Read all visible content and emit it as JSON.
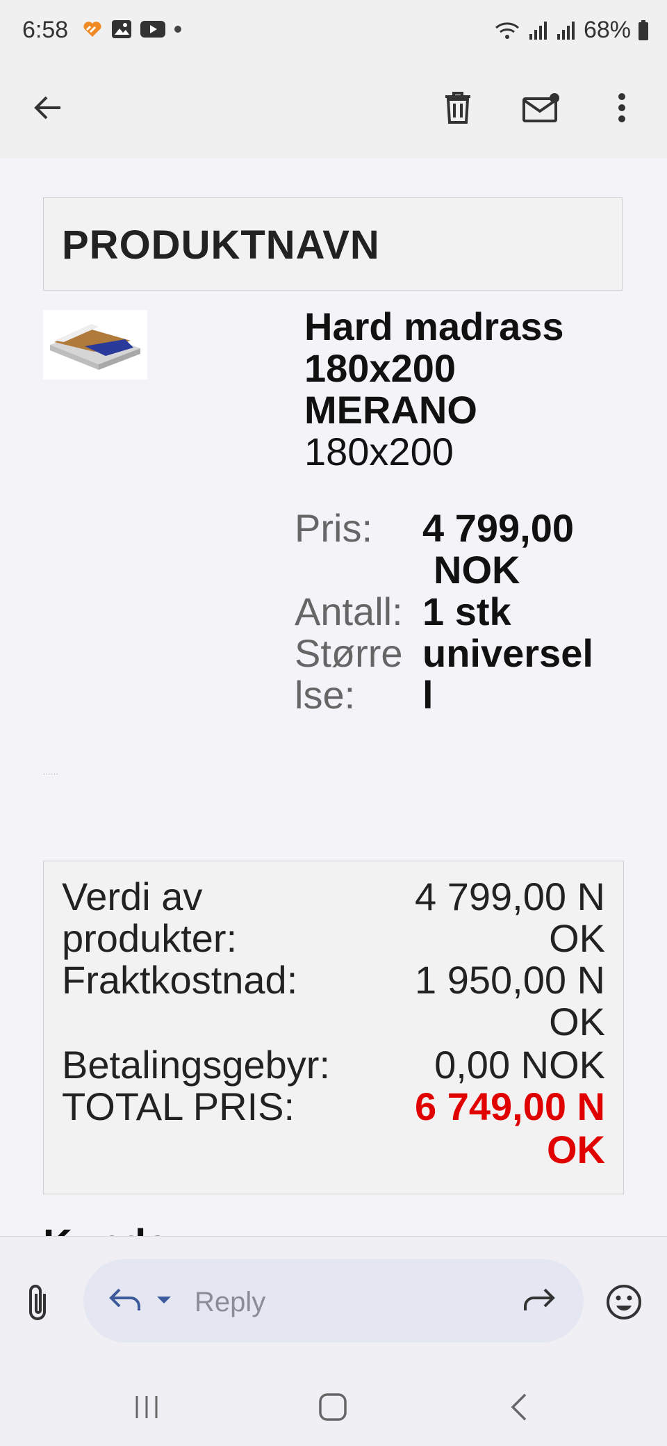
{
  "status_bar": {
    "time": "6:58",
    "battery": "68%"
  },
  "app_bar": {
    "icons": [
      "back-arrow-icon",
      "trash-icon",
      "mark-unread-icon",
      "more-vert-icon"
    ]
  },
  "email": {
    "product_header": "PRODUKTNAVN",
    "product": {
      "name_line1": "Hard madrass",
      "name_line2": "180x200",
      "name_line3": "MERANO",
      "variant": "180x200",
      "price_label": "Pris:",
      "price_value_line1": "4 799,00",
      "price_value_line2": "NOK",
      "qty_label": "Antall:",
      "qty_value": "1 stk",
      "size_label_line1": "Større",
      "size_label_line2": "lse:",
      "size_value_line1": "universel",
      "size_value_line2": "l"
    },
    "separator_dots": "......",
    "summary": {
      "products_label_line1": "Verdi av",
      "products_label_line2": "produkter:",
      "products_value_line1": "4 799,00 N",
      "products_value_line2": "OK",
      "shipping_label": "Fraktkostnad:",
      "shipping_value_line1": "1 950,00 N",
      "shipping_value_line2": "OK",
      "fee_label": "Betalingsgebyr:",
      "fee_value": "0,00 NOK",
      "total_label": "TOTAL PRIS:",
      "total_value_line1": "6 749,00 N",
      "total_value_line2": "OK"
    },
    "next_heading_partial": "Kunde"
  },
  "reply_bar": {
    "placeholder": "Reply",
    "icons": [
      "attach-icon",
      "reply-icon",
      "dropdown-icon",
      "forward-icon",
      "emoji-icon"
    ]
  },
  "nav_bar": {
    "icons": [
      "recents-icon",
      "home-icon",
      "back-icon"
    ]
  },
  "colors": {
    "accent": "#3c5a9a",
    "total_red": "#e00000",
    "reply_pill": "#e4e7f1"
  }
}
